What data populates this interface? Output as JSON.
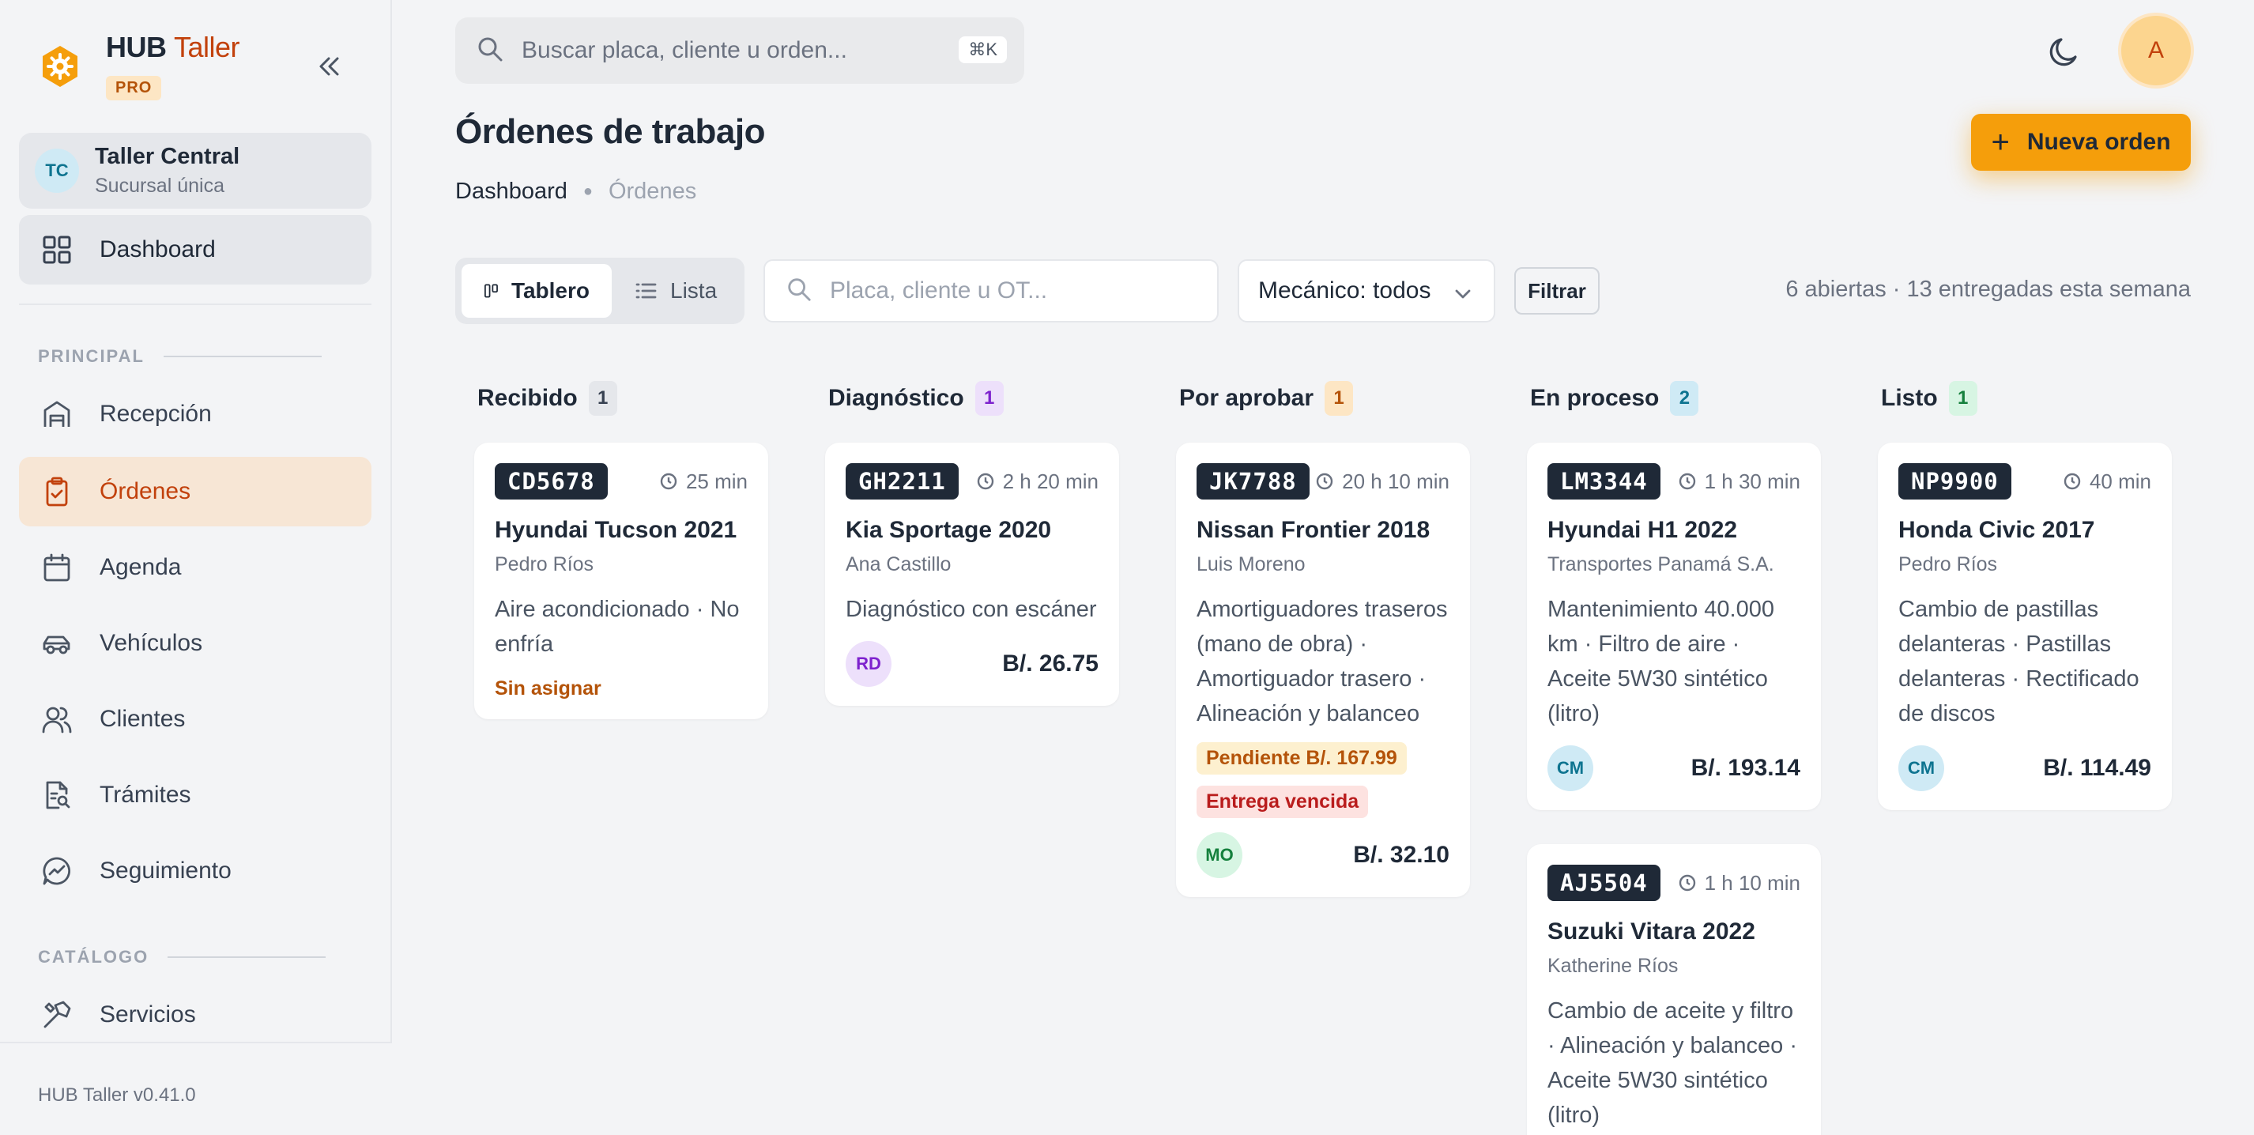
{
  "brand": {
    "name_a": "HUB",
    "name_b": "Taller",
    "badge": "PRO"
  },
  "branch": {
    "initials": "TC",
    "name": "Taller Central",
    "sub": "Sucursal única"
  },
  "nav": {
    "dashboard": "Dashboard",
    "section_principal": "PRINCIPAL",
    "recepcion": "Recepción",
    "ordenes": "Órdenes",
    "agenda": "Agenda",
    "vehiculos": "Vehículos",
    "clientes": "Clientes",
    "tramites": "Trámites",
    "seguimiento": "Seguimiento",
    "section_catalogo": "CATÁLOGO",
    "servicios": "Servicios"
  },
  "version": "HUB Taller v0.41.0",
  "topbar": {
    "search_placeholder": "Buscar placa, cliente u orden...",
    "shortcut": "⌘K",
    "user_initial": "A"
  },
  "page": {
    "title": "Órdenes de trabajo",
    "breadcrumb": [
      "Dashboard",
      "Órdenes"
    ],
    "new_order": "Nueva orden"
  },
  "toolbar": {
    "view_board": "Tablero",
    "view_list": "Lista",
    "search_placeholder": "Placa, cliente u OT...",
    "mechanic_filter": "Mecánico: todos",
    "filter_button": "Filtrar",
    "summary": "6 abiertas · 13 entregadas esta semana"
  },
  "colors": {
    "accent": "#f59e0b",
    "active_nav": "#c2410c",
    "dark": "#1f2937"
  },
  "columns": [
    {
      "title": "Recibido",
      "count": "1",
      "cards": [
        {
          "plate": "CD5678",
          "time": "25 min",
          "vehicle": "Hyundai Tucson 2021",
          "client": "Pedro Ríos",
          "desc": "Aire acondicionado · No enfría",
          "status": "Sin asignar"
        }
      ]
    },
    {
      "title": "Diagnóstico",
      "count": "1",
      "cards": [
        {
          "plate": "GH2211",
          "time": "2 h 20 min",
          "vehicle": "Kia Sportage 2020",
          "client": "Ana Castillo",
          "desc": "Diagnóstico con escáner",
          "mechanic": "RD",
          "price": "B/. 26.75"
        }
      ]
    },
    {
      "title": "Por aprobar",
      "count": "1",
      "cards": [
        {
          "plate": "JK7788",
          "time": "20 h 10 min",
          "vehicle": "Nissan Frontier 2018",
          "client": "Luis Moreno",
          "desc": "Amortiguadores traseros (mano de obra) · Amortiguador trasero · Alineación y balanceo",
          "pending": "Pendiente B/. 167.99",
          "overdue": "Entrega vencida",
          "mechanic": "MO",
          "price": "B/. 32.10"
        }
      ]
    },
    {
      "title": "En proceso",
      "count": "2",
      "cards": [
        {
          "plate": "LM3344",
          "time": "1 h 30 min",
          "vehicle": "Hyundai H1 2022",
          "client": "Transportes Panamá S.A.",
          "desc": "Mantenimiento 40.000 km · Filtro de aire · Aceite 5W30 sintético (litro)",
          "mechanic": "CM",
          "price": "B/. 193.14"
        },
        {
          "plate": "AJ5504",
          "time": "1 h 10 min",
          "vehicle": "Suzuki Vitara 2022",
          "client": "Katherine Ríos",
          "desc": "Cambio de aceite y filtro · Alineación y balanceo · Aceite 5W30 sintético (litro)"
        }
      ]
    },
    {
      "title": "Listo",
      "count": "1",
      "cards": [
        {
          "plate": "NP9900",
          "time": "40 min",
          "vehicle": "Honda Civic 2017",
          "client": "Pedro Ríos",
          "desc": "Cambio de pastillas delanteras · Pastillas delanteras · Rectificado de discos",
          "mechanic": "CM",
          "price": "B/. 114.49"
        }
      ]
    }
  ]
}
